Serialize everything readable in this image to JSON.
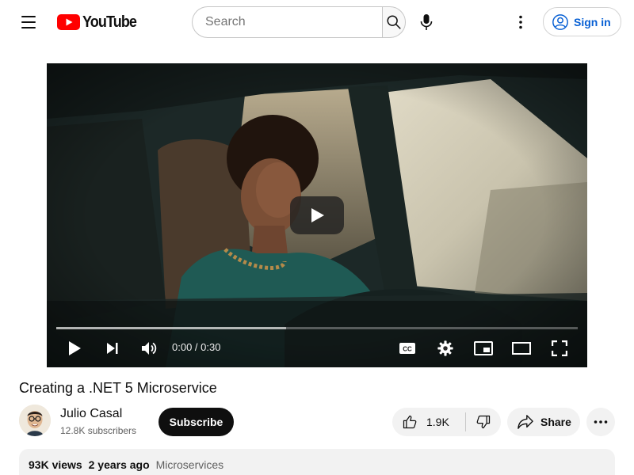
{
  "header": {
    "logo_text": "YouTube",
    "search": {
      "placeholder": "Search",
      "value": ""
    },
    "sign_in_label": "Sign in",
    "brand_red": "#ff0000",
    "link_blue": "#065fd4"
  },
  "player": {
    "time_display": "0:00 / 0:30",
    "progress": 0.44,
    "controls": [
      "play-icon",
      "next-icon",
      "volume-icon",
      "captions-icon",
      "settings-icon",
      "miniplayer-icon",
      "theater-icon",
      "fullscreen-icon"
    ]
  },
  "video": {
    "title": "Creating a .NET 5 Microservice",
    "views": "93K views",
    "date": "2 years ago",
    "tag": "Microservices"
  },
  "channel": {
    "name": "Julio Casal",
    "subscribers": "12.8K subscribers",
    "subscribe_label": "Subscribe"
  },
  "actions": {
    "like_count": "1.9K",
    "share_label": "Share"
  }
}
